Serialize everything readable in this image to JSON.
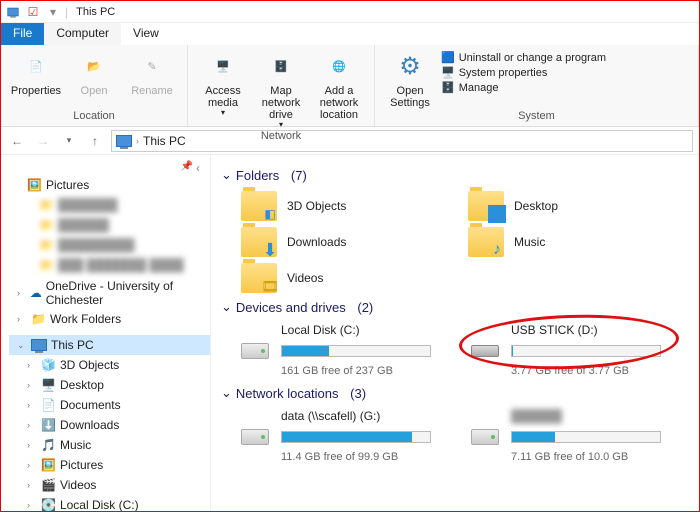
{
  "window": {
    "title": "This PC"
  },
  "tabs": {
    "file": "File",
    "computer": "Computer",
    "view": "View"
  },
  "ribbon": {
    "location": {
      "properties": "Properties",
      "open": "Open",
      "rename": "Rename",
      "label": "Location"
    },
    "network": {
      "access": "Access media",
      "map": "Map network drive",
      "add": "Add a network location",
      "label": "Network"
    },
    "system": {
      "open": "Open Settings",
      "uninstall": "Uninstall or change a program",
      "props": "System properties",
      "manage": "Manage",
      "label": "System"
    }
  },
  "address": {
    "location": "This PC"
  },
  "sidebar": {
    "pictures": "Pictures",
    "blurred": [
      "███████",
      "██████",
      "█████████",
      "███ ███████ ████"
    ],
    "onedrive": "OneDrive - University of Chichester",
    "work": "Work Folders",
    "thispc": "This PC",
    "children": [
      "3D Objects",
      "Desktop",
      "Documents",
      "Downloads",
      "Music",
      "Pictures",
      "Videos",
      "Local Disk (C:)"
    ]
  },
  "sections": {
    "folders": {
      "title": "Folders",
      "count": "(7)",
      "items": [
        "3D Objects",
        "Desktop",
        "Downloads",
        "Music",
        "Videos"
      ]
    },
    "drives": {
      "title": "Devices and drives",
      "count": "(2)",
      "items": [
        {
          "name": "Local Disk (C:)",
          "free": "161 GB free of 237 GB",
          "fill": 32
        },
        {
          "name": "USB STICK (D:)",
          "free": "3.77 GB free of 3.77 GB",
          "fill": 1
        }
      ]
    },
    "netloc": {
      "title": "Network locations",
      "count": "(3)",
      "items": [
        {
          "name": "data (\\\\scafell) (G:)",
          "free": "11.4 GB free of 99.9 GB",
          "fill": 88
        },
        {
          "name": "██████",
          "free": "7.11 GB free of 10.0 GB",
          "fill": 29
        }
      ]
    }
  }
}
